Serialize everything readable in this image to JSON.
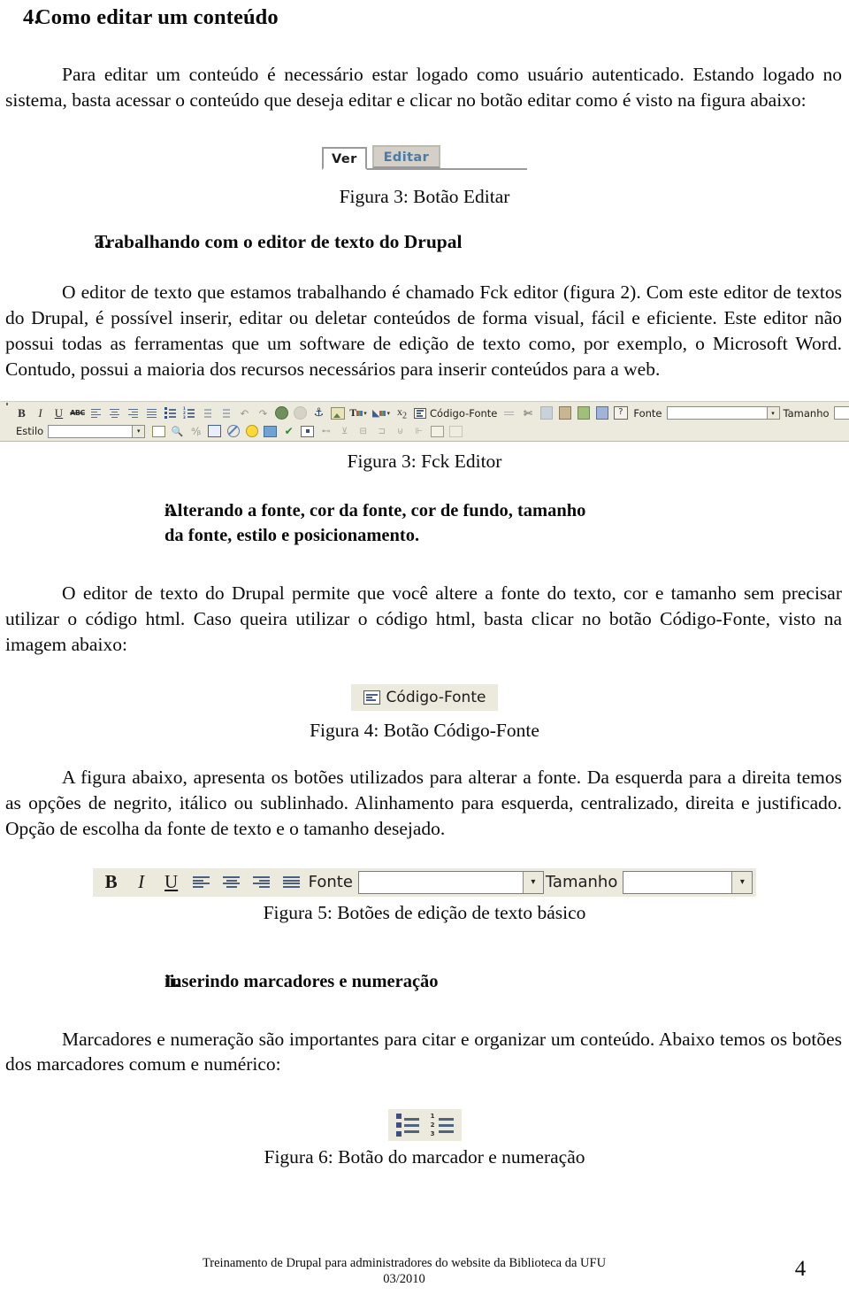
{
  "document": {
    "section_number": "4.",
    "section_title": "Como editar um conteúdo",
    "intro_paragraph": "Para editar um conteúdo é necessário estar logado como usuário autenticado. Estando logado no sistema, basta acessar o conteúdo que deseja editar e clicar no botão editar como é visto na figura abaixo:",
    "subsection_a": {
      "marker": "a.",
      "title": "Trabalhando com o editor de texto do Drupal",
      "paragraph": "O editor de texto que estamos trabalhando é chamado Fck editor (figura 2). Com este editor de textos do Drupal, é possível inserir, editar ou deletar conteúdos de forma visual, fácil e eficiente. Este editor não possui todas as ferramentas que um software de edição de texto como, por exemplo, o Microsoft Word. Contudo, possui a maioria dos recursos necessários para inserir conteúdos para a web."
    },
    "subsection_i": {
      "marker": "i.",
      "title": "Alterando a fonte, cor da fonte, cor de fundo, tamanho da fonte, estilo e posicionamento.",
      "paragraph": "O editor de texto do Drupal permite que você altere a fonte do texto, cor e tamanho sem precisar utilizar o código html. Caso queira utilizar o código html, basta clicar no botão Código-Fonte, visto na imagem abaixo:",
      "paragraph2": "A figura abaixo, apresenta os botões utilizados para alterar a fonte. Da esquerda para a direita temos as opções de negrito, itálico ou sublinhado. Alinhamento para esquerda, centralizado, direita e justificado. Opção de escolha da fonte de texto e o tamanho desejado."
    },
    "subsection_ii": {
      "marker": "ii.",
      "title": "Inserindo marcadores e numeração",
      "paragraph": "Marcadores e numeração são importantes para citar e organizar um conteúdo. Abaixo temos os botões dos marcadores comum e numérico:"
    }
  },
  "figures": {
    "fig3_tabs": {
      "caption": "Figura 3: Botão Editar",
      "tab_view": "Ver",
      "tab_edit": "Editar",
      "active_tab_color": "#4a7ba6"
    },
    "fig3_fck": {
      "caption": "Figura 3: Fck Editor",
      "toolbar_bg": "#eceadd",
      "row1": [
        {
          "name": "bold-icon",
          "label": "B"
        },
        {
          "name": "italic-icon",
          "label": "I"
        },
        {
          "name": "underline-icon",
          "label": "U"
        },
        {
          "name": "strikethrough-icon",
          "label": "ABC"
        },
        {
          "name": "align-left-icon",
          "label": ""
        },
        {
          "name": "align-center-icon",
          "label": ""
        },
        {
          "name": "align-right-icon",
          "label": ""
        },
        {
          "name": "align-justify-icon",
          "label": ""
        },
        {
          "name": "bulleted-list-icon",
          "label": ""
        },
        {
          "name": "numbered-list-icon",
          "label": ""
        },
        {
          "name": "decrease-indent-icon",
          "label": ""
        },
        {
          "name": "increase-indent-icon",
          "label": ""
        },
        {
          "name": "undo-icon",
          "label": ""
        },
        {
          "name": "redo-icon",
          "label": ""
        },
        {
          "name": "link-icon",
          "label": ""
        },
        {
          "name": "unlink-icon",
          "label": ""
        },
        {
          "name": "anchor-icon",
          "label": ""
        },
        {
          "name": "image-icon",
          "label": ""
        },
        {
          "name": "text-color-icon",
          "label": "T"
        },
        {
          "name": "background-color-icon",
          "label": ""
        },
        {
          "name": "subscript-icon",
          "label": "x"
        },
        {
          "name": "source-code-button",
          "label": "Código-Fonte"
        },
        {
          "name": "horizontal-rule-icon",
          "label": ""
        },
        {
          "name": "cut-icon",
          "label": ""
        },
        {
          "name": "copy-icon",
          "label": ""
        },
        {
          "name": "paste-icon",
          "label": ""
        },
        {
          "name": "paste-text-icon",
          "label": ""
        },
        {
          "name": "paste-word-icon",
          "label": ""
        },
        {
          "name": "about-icon",
          "label": "?"
        }
      ],
      "font_label": "Fonte",
      "font_value": "",
      "size_label": "Tamanho",
      "size_value": "",
      "style_label": "Estilo",
      "style_value": "",
      "row2": [
        {
          "name": "table-icon",
          "label": ""
        },
        {
          "name": "find-icon",
          "label": ""
        },
        {
          "name": "replace-icon",
          "label": ""
        },
        {
          "name": "show-blocks-icon",
          "label": ""
        },
        {
          "name": "no-entry-icon",
          "label": ""
        },
        {
          "name": "smiley-icon",
          "label": ""
        },
        {
          "name": "flash-icon",
          "label": ""
        },
        {
          "name": "spellcheck-icon",
          "label": ""
        },
        {
          "name": "select-all-icon",
          "label": ""
        },
        {
          "name": "form-checkbox-icon",
          "label": ""
        },
        {
          "name": "form-radio-icon",
          "label": ""
        },
        {
          "name": "form-textfield-icon",
          "label": ""
        },
        {
          "name": "form-textarea-icon",
          "label": ""
        },
        {
          "name": "form-select-icon",
          "label": ""
        },
        {
          "name": "form-button-icon",
          "label": ""
        },
        {
          "name": "table-cell-icon",
          "label": ""
        },
        {
          "name": "table-merge-icon",
          "label": ""
        }
      ]
    },
    "fig4_source": {
      "caption": "Figura 4: Botão Código-Fonte",
      "button_label": "Código-Fonte"
    },
    "fig5_basic": {
      "caption": "Figura 5: Botões de edição de texto básico",
      "bold_label": "B",
      "italic_label": "I",
      "underline_label": "U",
      "font_label": "Fonte",
      "font_value": "",
      "size_label": "Tamanho",
      "size_value": ""
    },
    "fig6_lists": {
      "caption": "Figura 6: Botão do marcador e numeração",
      "numbers": [
        "1",
        "2",
        "3"
      ]
    }
  },
  "footer": {
    "line1": "Treinamento de Drupal para administradores do website da Biblioteca da UFU",
    "line2": "03/2010",
    "page_number": "4"
  }
}
